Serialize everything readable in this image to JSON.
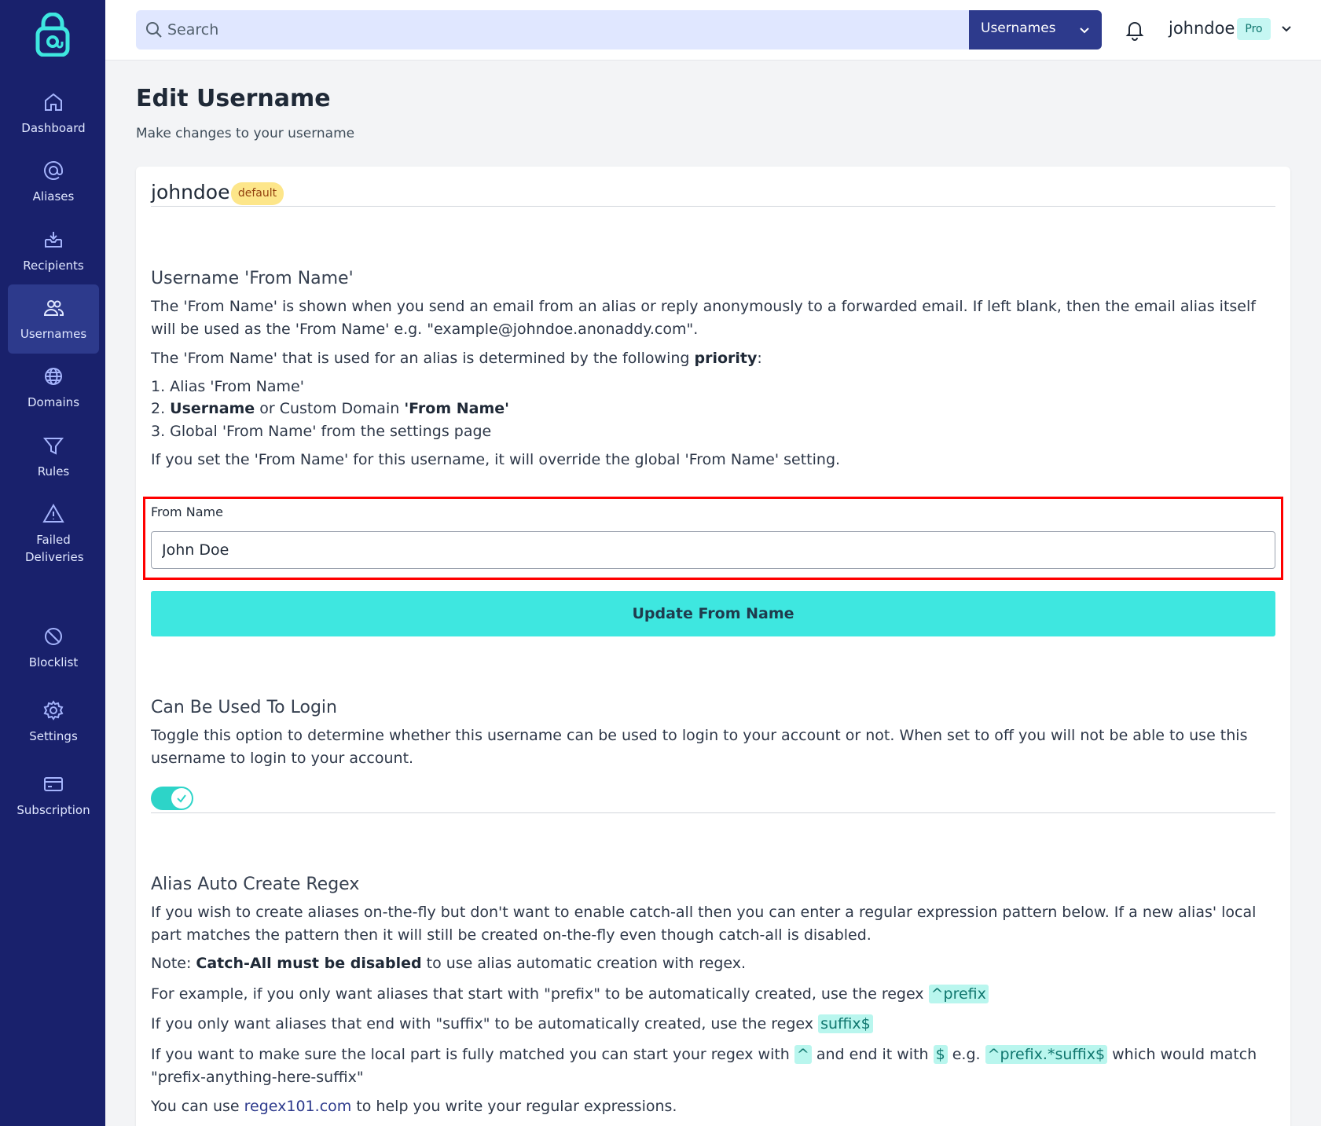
{
  "sidebar": {
    "items": [
      {
        "label": "Dashboard",
        "icon": "home-icon"
      },
      {
        "label": "Aliases",
        "icon": "at-icon"
      },
      {
        "label": "Recipients",
        "icon": "inbox-icon"
      },
      {
        "label": "Usernames",
        "icon": "users-icon",
        "active": true
      },
      {
        "label": "Domains",
        "icon": "globe-icon"
      },
      {
        "label": "Rules",
        "icon": "filter-icon"
      },
      {
        "label": "Failed Deliveries",
        "icon": "warning-icon"
      },
      {
        "label": "Blocklist",
        "icon": "block-icon"
      },
      {
        "label": "Settings",
        "icon": "gear-icon"
      },
      {
        "label": "Subscription",
        "icon": "credit-card-icon"
      }
    ]
  },
  "topbar": {
    "search_placeholder": "Search",
    "search_scope": "Usernames",
    "user_name": "johndoe",
    "plan_badge": "Pro"
  },
  "page": {
    "title": "Edit Username",
    "subtitle": "Make changes to your username"
  },
  "username": {
    "name": "johndoe",
    "badge": "default"
  },
  "from_name_section": {
    "heading": "Username 'From Name'",
    "para1": "The 'From Name' is shown when you send an email from an alias or reply anonymously to a forwarded email. If left blank, then the email alias itself will be used as the 'From Name' e.g. \"example@johndoe.anonaddy.com\".",
    "para2_prefix": "The 'From Name' that is used for an alias is determined by the following ",
    "para2_bold": "priority",
    "para2_suffix": ":",
    "list1": "1. Alias 'From Name'",
    "list2_prefix": "2. ",
    "list2_bold1": "Username",
    "list2_mid": " or Custom Domain ",
    "list2_bold2": "'From Name'",
    "list3": "3. Global 'From Name' from the settings page",
    "para3": "If you set the 'From Name' for this username, it will override the global 'From Name' setting.",
    "field_label": "From Name",
    "field_value": "John Doe",
    "button_label": "Update From Name"
  },
  "login_section": {
    "heading": "Can Be Used To Login",
    "para": "Toggle this option to determine whether this username can be used to login to your account or not. When set to off you will not be able to use this username to login to your account.",
    "toggle_on": true
  },
  "regex_section": {
    "heading": "Alias Auto Create Regex",
    "para1": "If you wish to create aliases on-the-fly but don't want to enable catch-all then you can enter a regular expression pattern below. If a new alias' local part matches the pattern then it will still be created on-the-fly even though catch-all is disabled.",
    "note_prefix": "Note: ",
    "note_bold": "Catch-All must be disabled",
    "note_suffix": " to use alias automatic creation with regex.",
    "ex1_prefix": "For example, if you only want aliases that start with \"prefix\" to be automatically created, use the regex ",
    "ex1_code": "^prefix",
    "ex2_prefix": "If you only want aliases that end with \"suffix\" to be automatically created, use the regex ",
    "ex2_code": "suffix$",
    "ex3_a": "If you want to make sure the local part is fully matched you can start your regex with ",
    "ex3_code1": "^",
    "ex3_b": " and end it with ",
    "ex3_code2": "$",
    "ex3_c": " e.g. ",
    "ex3_code3": "^prefix.*suffix$",
    "ex3_d": " which would match \"prefix-anything-here-suffix\"",
    "help_prefix": "You can use ",
    "help_link": "regex101.com",
    "help_suffix": " to help you write your regular expressions."
  },
  "colors": {
    "sidebar_bg": "#19216c",
    "sidebar_active": "#2d3a8c",
    "accent": "#3ee7e0",
    "highlight_border": "#ff0000"
  }
}
